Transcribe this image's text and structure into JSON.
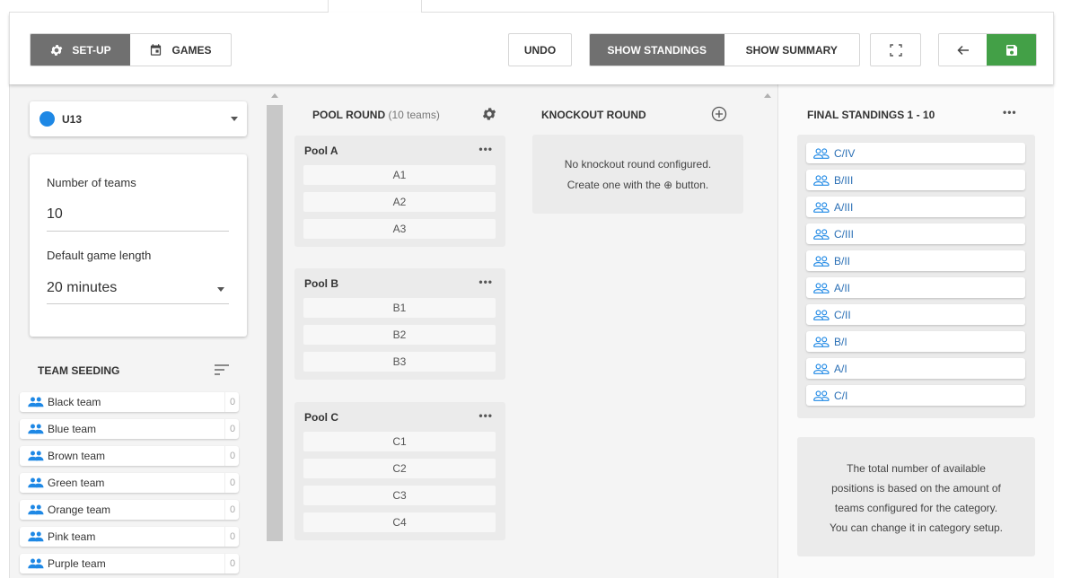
{
  "toolbar": {
    "setup_label": "SET-UP",
    "games_label": "GAMES",
    "undo_label": "UNDO",
    "show_standings_label": "SHOW STANDINGS",
    "show_summary_label": "SHOW SUMMARY"
  },
  "category": {
    "name": "U13",
    "color": "#1e88e5"
  },
  "settings": {
    "number_of_teams_label": "Number of teams",
    "number_of_teams_value": "10",
    "game_length_label": "Default game length",
    "game_length_value": "20 minutes"
  },
  "seeding": {
    "title": "TEAM SEEDING",
    "teams": [
      {
        "name": "Black team",
        "seed": "0"
      },
      {
        "name": "Blue team",
        "seed": "0"
      },
      {
        "name": "Brown team",
        "seed": "0"
      },
      {
        "name": "Green team",
        "seed": "0"
      },
      {
        "name": "Orange team",
        "seed": "0"
      },
      {
        "name": "Pink team",
        "seed": "0"
      },
      {
        "name": "Purple team",
        "seed": "0"
      }
    ]
  },
  "pool_round": {
    "title": "POOL ROUND",
    "count": "(10 teams)",
    "pools": [
      {
        "name": "Pool A",
        "dots": "•••",
        "slots": [
          "A1",
          "A2",
          "A3"
        ]
      },
      {
        "name": "Pool B",
        "dots": "•••",
        "slots": [
          "B1",
          "B2",
          "B3"
        ]
      },
      {
        "name": "Pool C",
        "dots": "•••",
        "slots": [
          "C1",
          "C2",
          "C3",
          "C4"
        ]
      }
    ]
  },
  "knockout": {
    "title": "KNOCKOUT ROUND",
    "empty_line1": "No knockout round configured.",
    "empty_line2": "Create one with the ⊕ button."
  },
  "standings": {
    "title": "FINAL STANDINGS 1 - 10",
    "dots": "•••",
    "items": [
      "C/IV",
      "B/III",
      "A/III",
      "C/III",
      "B/II",
      "A/II",
      "C/II",
      "B/I",
      "A/I",
      "C/I"
    ],
    "note_line1": "The total number of available",
    "note_line2": "positions is based on the amount of",
    "note_line3": "teams configured for the category.",
    "note_line4": "You can change it in category setup."
  },
  "colors": {
    "save_green": "#43a047",
    "accent_blue": "#1e88e5",
    "toggle_dark": "#707070"
  }
}
